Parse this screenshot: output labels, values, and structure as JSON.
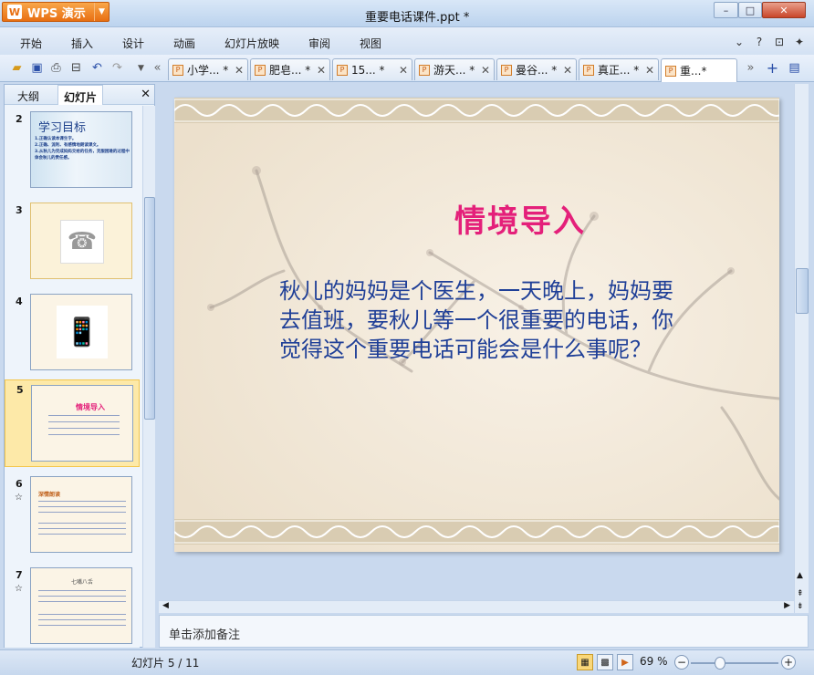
{
  "app": {
    "logo_text": "WPS 演示",
    "doc_title": "重要电话课件.ppt *"
  },
  "window": {
    "min": "–",
    "max": "□",
    "close": "✕"
  },
  "menu": [
    "开始",
    "插入",
    "设计",
    "动画",
    "幻灯片放映",
    "审阅",
    "视图"
  ],
  "tabs": [
    {
      "label": "小学... *",
      "close": "✕"
    },
    {
      "label": "肥皂... *",
      "close": "✕"
    },
    {
      "label": "15... *",
      "close": "✕"
    },
    {
      "label": "游天... *",
      "close": "✕"
    },
    {
      "label": "曼谷... *",
      "close": "✕"
    },
    {
      "label": "真正... *",
      "close": "✕"
    },
    {
      "label": "重...*",
      "close": ""
    }
  ],
  "panel": {
    "outline_tab": "大纲",
    "slides_tab": "幻灯片",
    "close": "✕"
  },
  "thumbs": [
    {
      "num": "2",
      "title": "学习目标",
      "lines": [
        "1.正确认读本课生字。",
        "2.正确、流利、有感情地朗读课文。",
        "3.从秋儿为完成妈妈交给的任务，克服困难的过程中体会秋儿的责任感。"
      ]
    },
    {
      "num": "3"
    },
    {
      "num": "4"
    },
    {
      "num": "5",
      "title": "情境导入"
    },
    {
      "num": "6",
      "star": "☆",
      "title": "深情朗读"
    },
    {
      "num": "7",
      "star": "☆",
      "title": "七嘴八舌"
    }
  ],
  "slide": {
    "title": "情境导入",
    "body": "秋儿的妈妈是个医生，一天晚上，妈妈要去值班，要秋儿等一个很重要的电话，你觉得这个重要电话可能会是什么事呢？"
  },
  "notes": {
    "placeholder": "单击添加备注"
  },
  "status": {
    "slide_counter": "幻灯片 5 / 11",
    "zoom": "69 %"
  }
}
